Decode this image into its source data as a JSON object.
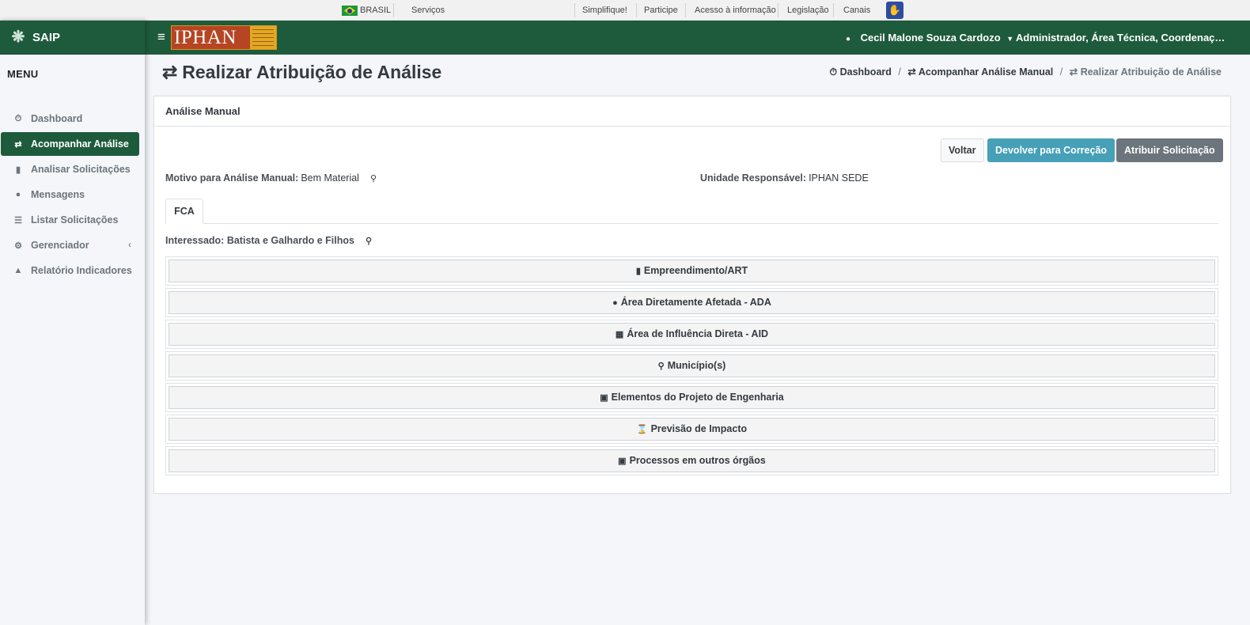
{
  "gov_bar": {
    "country": "BRASIL",
    "services": "Serviços",
    "links": [
      "Simplifique!",
      "Participe",
      "Acesso à informação",
      "Legislação",
      "Canais"
    ]
  },
  "sidebar": {
    "brand": "SAIP",
    "menu_title": "MENU",
    "items": [
      {
        "label": "Dashboard",
        "icon": "dashboard-icon"
      },
      {
        "label": "Acompanhar Análise",
        "icon": "exchange-icon",
        "active": true
      },
      {
        "label": "Analisar Solicitações",
        "icon": "book-icon"
      },
      {
        "label": "Mensagens",
        "icon": "comments-icon"
      },
      {
        "label": "Listar Solicitações",
        "icon": "list-icon"
      },
      {
        "label": "Gerenciador",
        "icon": "cogs-icon",
        "has_submenu": true
      },
      {
        "label": "Relatório Indicadores",
        "icon": "area-chart-icon"
      }
    ]
  },
  "navbar": {
    "logo_text": "IPHAN",
    "user_name": "Cecil Malone Souza Cardozo",
    "roles": "Administrador, Área Técnica, Coordenação..."
  },
  "page": {
    "title": "Realizar Atribuição de Análise",
    "breadcrumb": [
      "Dashboard",
      "Acompanhar Análise Manual",
      "Realizar Atribuição de Análise"
    ]
  },
  "card": {
    "header": "Análise Manual",
    "buttons": {
      "back": "Voltar",
      "return": "Devolver para Correção",
      "assign": "Atribuir Solicitação"
    },
    "motivo_label": "Motivo para Análise Manual:",
    "motivo_value": "Bem Material",
    "unidade_label": "Unidade Responsável:",
    "unidade_value": "IPHAN SEDE",
    "tab": "FCA",
    "interessado_label": "Interessado:",
    "interessado_value": "Batista e Galhardo e Filhos",
    "sections": [
      {
        "label": "Empreendimento/ART",
        "icon": "building-icon"
      },
      {
        "label": "Área Diretamente Afetada - ADA",
        "icon": "globe-icon"
      },
      {
        "label": "Área de Influência Direta - AID",
        "icon": "map-icon"
      },
      {
        "label": "Município(s)",
        "icon": "map-marker-icon"
      },
      {
        "label": "Elementos do Projeto de Engenharia",
        "icon": "cubes-icon"
      },
      {
        "label": "Previsão de Impacto",
        "icon": "hourglass-icon"
      },
      {
        "label": "Processos em outros órgãos",
        "icon": "archive-icon"
      }
    ]
  },
  "colors": {
    "primary_green": "#1e5b3c",
    "info": "#45a0b8",
    "secondary": "#6c757d"
  }
}
